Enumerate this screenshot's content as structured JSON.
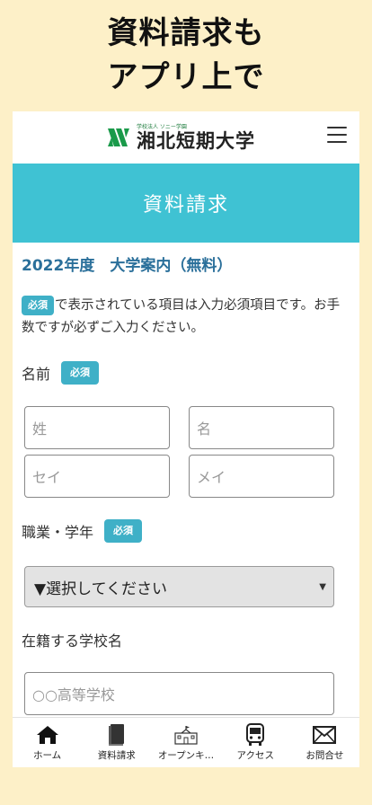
{
  "promo": {
    "line1": "資料請求も",
    "line2": "アプリ上で"
  },
  "header": {
    "logo_sub": "学校法人 ソニー学園",
    "logo_main": "湘北短期大学",
    "menu_icon": "hamburger-icon"
  },
  "hero": {
    "title": "資料請求"
  },
  "form": {
    "section_title": "2022年度　大学案内（無料）",
    "required_badge": "必須",
    "notice_text": "で表示されている項目は入力必須項目です。お手数ですが必ずご入力ください。",
    "name_label": "名前",
    "name_fields": {
      "last_placeholder": "姓",
      "first_placeholder": "名",
      "last_kana_placeholder": "セイ",
      "first_kana_placeholder": "メイ"
    },
    "occupation_label": "職業・学年",
    "occupation_select": "▼選択してください",
    "school_label": "在籍する学校名",
    "school_placeholder": "○○高等学校"
  },
  "tabs": [
    {
      "label": "ホーム",
      "icon": "home-icon"
    },
    {
      "label": "資料請求",
      "icon": "book-icon"
    },
    {
      "label": "オープンキ…",
      "icon": "school-building-icon"
    },
    {
      "label": "アクセス",
      "icon": "bus-icon"
    },
    {
      "label": "お問合せ",
      "icon": "mail-icon"
    }
  ],
  "colors": {
    "background": "#fdf0c8",
    "hero": "#3fc2d3",
    "badge": "#3fb0c7",
    "section_title": "#2a6f9a",
    "logo_green": "#1a9a4a"
  }
}
